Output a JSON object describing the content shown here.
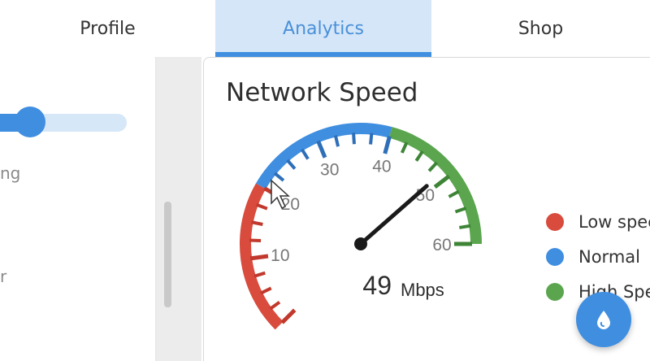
{
  "tabs": [
    {
      "label": "Profile",
      "active": false
    },
    {
      "label": "Analytics",
      "active": true
    },
    {
      "label": "Shop",
      "active": false
    }
  ],
  "left_panel": {
    "slider_value_fraction": 0.2,
    "text_1": "ng",
    "text_2": "r"
  },
  "card": {
    "title": "Network Speed"
  },
  "gauge": {
    "value": 49,
    "unit": "Mbps",
    "min": 0,
    "max": 60,
    "tick_labels": [
      "10",
      "20",
      "30",
      "40",
      "50",
      "60"
    ],
    "bands": [
      {
        "name": "Low speed",
        "from": 0,
        "to": 20,
        "color": "#d94b3d"
      },
      {
        "name": "Normal",
        "from": 20,
        "to": 40,
        "color": "#3f8ee0"
      },
      {
        "name": "High Speed",
        "from": 40,
        "to": 60,
        "color": "#5aa54e"
      }
    ]
  },
  "legend": [
    {
      "label": "Low speed",
      "color": "#d94b3d"
    },
    {
      "label": "Normal",
      "color": "#3f8ee0"
    },
    {
      "label": "High Speed",
      "color": "#5aa54e"
    }
  ],
  "fab": {
    "icon": "water-drop-icon"
  },
  "colors": {
    "accent": "#3f8ee0",
    "tab_active_bg": "#d4e6f8"
  }
}
